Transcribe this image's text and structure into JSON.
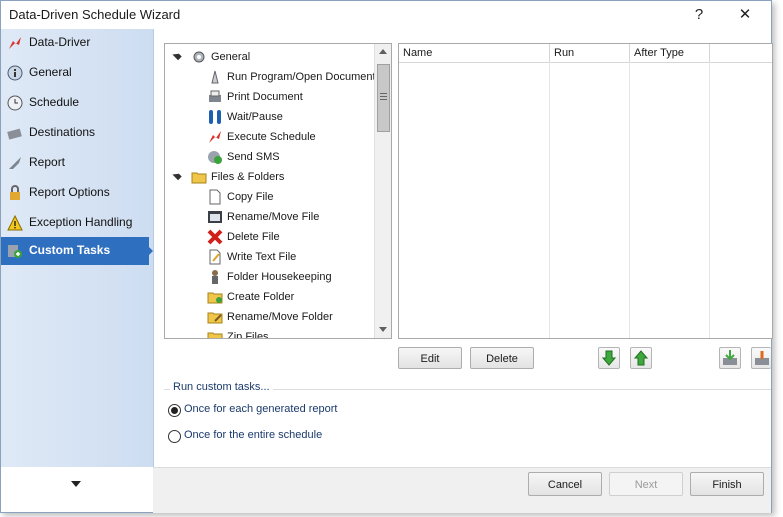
{
  "window": {
    "title": "Data-Driven Schedule Wizard",
    "help_label": "?",
    "close_label": "✕"
  },
  "sidebar": {
    "items": [
      {
        "label": "Data-Driver",
        "icon": "data-driver-icon"
      },
      {
        "label": "General",
        "icon": "info-icon"
      },
      {
        "label": "Schedule",
        "icon": "clock-icon"
      },
      {
        "label": "Destinations",
        "icon": "destinations-icon"
      },
      {
        "label": "Report",
        "icon": "report-icon"
      },
      {
        "label": "Report Options",
        "icon": "lock-icon"
      },
      {
        "label": "Exception Handling",
        "icon": "warning-icon"
      },
      {
        "label": "Custom Tasks",
        "icon": "custom-tasks-icon",
        "active": true
      }
    ]
  },
  "tree": {
    "items": [
      {
        "label": "General",
        "level": 0,
        "icon": "gear-icon"
      },
      {
        "label": "Run Program/Open Document",
        "level": 1,
        "icon": "run-program-icon"
      },
      {
        "label": "Print Document",
        "level": 1,
        "icon": "printer-icon"
      },
      {
        "label": "Wait/Pause",
        "level": 1,
        "icon": "pause-icon"
      },
      {
        "label": "Execute Schedule",
        "level": 1,
        "icon": "execute-icon"
      },
      {
        "label": "Send SMS",
        "level": 1,
        "icon": "sms-icon"
      },
      {
        "label": "Files & Folders",
        "level": 0,
        "icon": "folder-icon"
      },
      {
        "label": "Copy File",
        "level": 1,
        "icon": "copy-file-icon"
      },
      {
        "label": "Rename/Move File",
        "level": 1,
        "icon": "rename-file-icon"
      },
      {
        "label": "Delete File",
        "level": 1,
        "icon": "delete-icon"
      },
      {
        "label": "Write Text File",
        "level": 1,
        "icon": "write-text-icon"
      },
      {
        "label": "Folder Housekeeping",
        "level": 1,
        "icon": "housekeeping-icon"
      },
      {
        "label": "Create Folder",
        "level": 1,
        "icon": "create-folder-icon"
      },
      {
        "label": "Rename/Move Folder",
        "level": 1,
        "icon": "rename-folder-icon"
      },
      {
        "label": "Zip Files",
        "level": 1,
        "icon": "zip-icon"
      }
    ]
  },
  "list": {
    "columns": [
      "Name",
      "Run",
      "After Type"
    ]
  },
  "actions": {
    "edit_label": "Edit",
    "delete_label": "Delete"
  },
  "run_group": {
    "title": "Run custom tasks...",
    "options": [
      {
        "label": "Once for each generated report",
        "selected": true
      },
      {
        "label": "Once for the entire schedule",
        "selected": false
      }
    ]
  },
  "footer": {
    "cancel_label": "Cancel",
    "next_label": "Next",
    "finish_label": "Finish"
  },
  "colors": {
    "accent": "#2f6fc0",
    "sidebar_bg": "#d6e3f4"
  }
}
